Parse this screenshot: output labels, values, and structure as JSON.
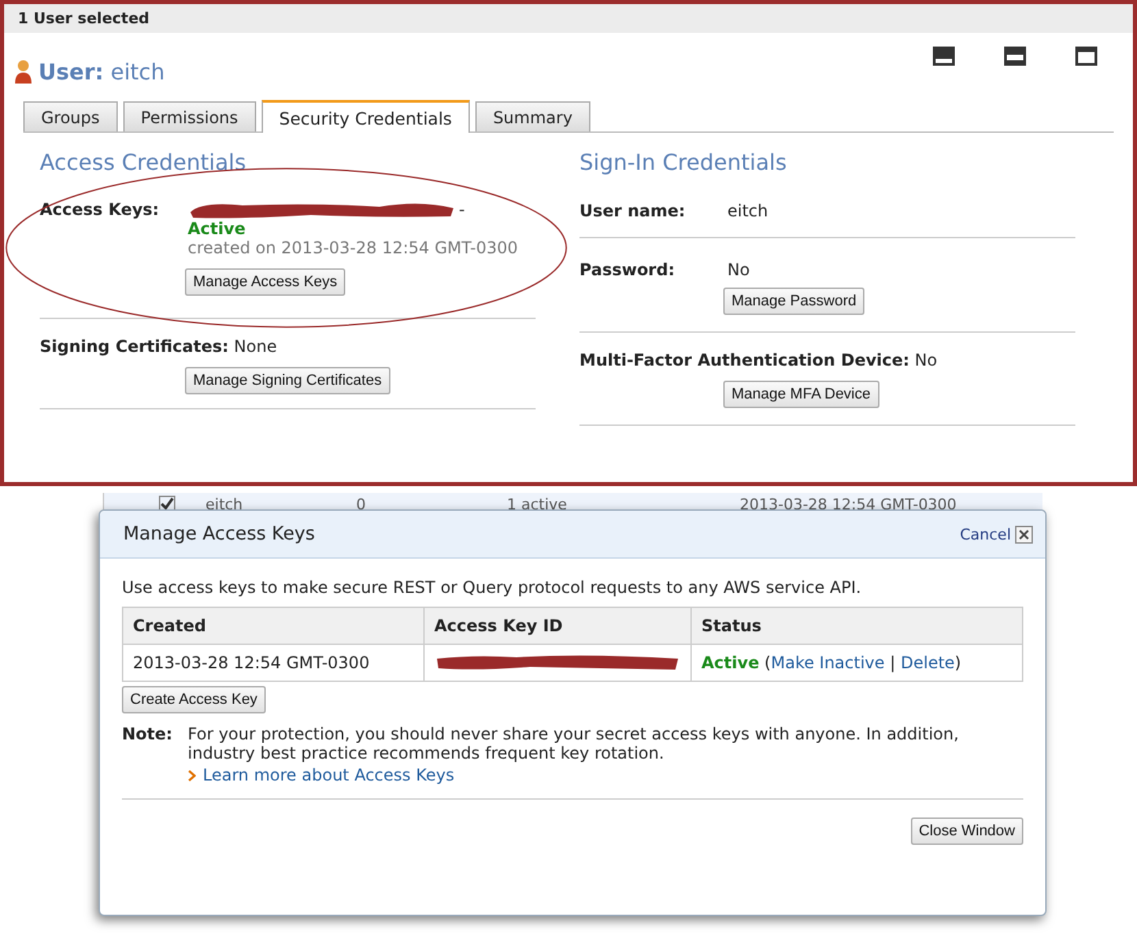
{
  "selection_bar": {
    "text": "1 User selected"
  },
  "user": {
    "label": "User:",
    "name": "eitch"
  },
  "tabs": [
    {
      "label": "Groups",
      "selected": false
    },
    {
      "label": "Permissions",
      "selected": false
    },
    {
      "label": "Security Credentials",
      "selected": true
    },
    {
      "label": "Summary",
      "selected": false
    }
  ],
  "access_credentials": {
    "title": "Access Credentials",
    "access_keys": {
      "label": "Access Keys:",
      "separator": "-",
      "status": "Active",
      "created": "created on 2013-03-28 12:54 GMT-0300",
      "button": "Manage Access Keys"
    },
    "signing_certificates": {
      "label": "Signing Certificates:",
      "value": "None",
      "button": "Manage Signing Certificates"
    }
  },
  "sign_in_credentials": {
    "title": "Sign-In Credentials",
    "rows": [
      {
        "kind": "pair",
        "label": "User name:",
        "value": "eitch"
      },
      {
        "kind": "pair",
        "label": "Password:",
        "value": "No",
        "button": "Manage Password"
      },
      {
        "kind": "inline",
        "label": "Multi-Factor Authentication Device:",
        "value": "No",
        "button": "Manage MFA Device"
      }
    ]
  },
  "background_table": {
    "checked": true,
    "cells": [
      "eitch",
      "0",
      "1 active",
      "2013-03-28 12:54 GMT-0300"
    ]
  },
  "dialog": {
    "title": "Manage Access Keys",
    "cancel": "Cancel",
    "intro": "Use access keys to make secure REST or Query protocol requests to any AWS service API.",
    "columns": [
      "Created",
      "Access Key ID",
      "Status"
    ],
    "rows": [
      {
        "created": "2013-03-28 12:54 GMT-0300",
        "status": "Active",
        "open": "(",
        "actions": [
          "Make Inactive",
          "Delete"
        ],
        "separator": "|",
        "close": ")"
      }
    ],
    "create_button": "Create Access Key",
    "note_label": "Note:",
    "note": "For your protection, you should never share your secret access keys with anyone. In addition, industry best practice recommends frequent key rotation.",
    "learn_more": "Learn more about Access Keys",
    "close_button": "Close Window"
  }
}
